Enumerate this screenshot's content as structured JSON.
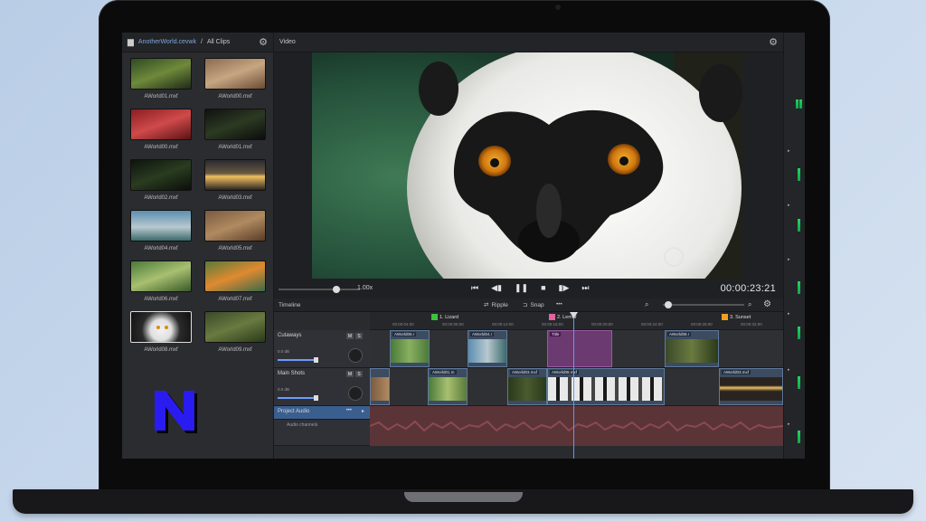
{
  "browser": {
    "path_root": "AnotherWorld.cevwk",
    "path_sep": "/",
    "path_current": "All Clips",
    "clips": [
      {
        "name": "AWorld01.mxf"
      },
      {
        "name": "AWorld00.mxf"
      },
      {
        "name": "AWorld00.mxf"
      },
      {
        "name": "AWorld01.mxf"
      },
      {
        "name": "AWorld02.mxf"
      },
      {
        "name": "AWorld03.mxf"
      },
      {
        "name": "AWorld04.mxf"
      },
      {
        "name": "AWorld05.mxf"
      },
      {
        "name": "AWorld06.mxf"
      },
      {
        "name": "AWorld07.mxf"
      },
      {
        "name": "AWorld08.mxf"
      },
      {
        "name": "AWorld09.mxf"
      }
    ],
    "logo_text": "N"
  },
  "viewer": {
    "title": "Video",
    "watermark_line1": "Another",
    "watermark_line2": "World",
    "speed": "1.00x",
    "timecode": "00:00:23:21"
  },
  "timeline": {
    "title": "Timeline",
    "ripple_label": "Ripple",
    "snap_label": "Snap",
    "markers": [
      {
        "label": "1. Lizard",
        "color": "#3fbf3f"
      },
      {
        "label": "2. Lemur",
        "color": "#e2649c"
      },
      {
        "label": "3. Sunset",
        "color": "#f0a020"
      }
    ],
    "tracks": [
      {
        "name": "Cutaways",
        "level": "0.0 dB"
      },
      {
        "name": "Main Shots",
        "level": "0.0 dB"
      },
      {
        "name": "Project Audio"
      }
    ],
    "audio_channels_label": "Audio channels",
    "clip_labels": {
      "c1": "AWorld06.r",
      "c2": "AWorld04.r",
      "title": "Title",
      "c3": "AWorld08.r",
      "m1": "AWorld01.m",
      "m2": "AWorld03.mxf",
      "m3": "AWorld08.mxf",
      "m4": "AWorld03.mxf"
    },
    "ruler_ticks": [
      "00:00:04:00",
      "00:00:08:00",
      "00:00:12:00",
      "00:00:16:00",
      "00:00:20:00",
      "00:00:24:00",
      "00:00:28:00",
      "00:00:32:00"
    ]
  },
  "colors": {
    "accent": "#5a9cff",
    "logo": "#2a1cf0",
    "meter": "#1dd760"
  }
}
